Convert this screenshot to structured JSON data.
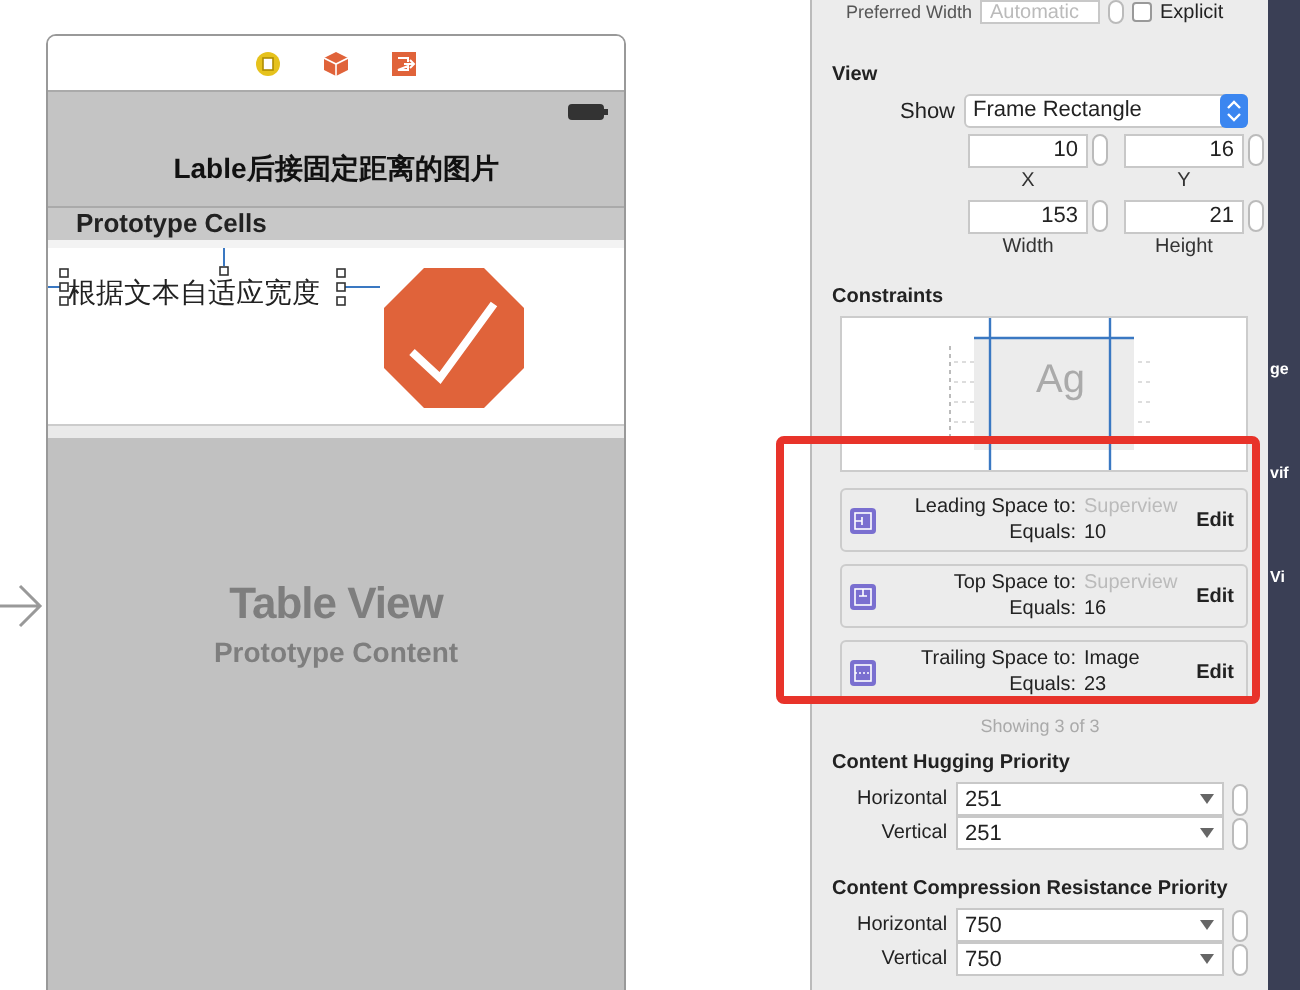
{
  "scene": {
    "title": "Lable后接固定距离的图片",
    "section_header": "Prototype Cells",
    "cell": {
      "label": "根据文本自适应宽度"
    },
    "table_placeholder": {
      "title": "Table View",
      "subtitle": "Prototype Content"
    }
  },
  "inspector": {
    "preferred_width": {
      "label": "Preferred Width",
      "placeholder": "Automatic",
      "explicit": {
        "label": "Explicit",
        "checked": false
      }
    },
    "view": {
      "heading": "View",
      "show": {
        "label": "Show",
        "value": "Frame Rectangle"
      },
      "fields": [
        {
          "label": "X",
          "value": "10"
        },
        {
          "label": "Y",
          "value": "16"
        },
        {
          "label": "Width",
          "value": "153"
        },
        {
          "label": "Height",
          "value": "21"
        }
      ]
    },
    "constraints": {
      "heading": "Constraints",
      "preview_text": "Ag",
      "items": [
        {
          "kind": "leading",
          "relation": "Leading Space to:",
          "target": "Superview",
          "target_dimmed": true,
          "equals_label": "Equals:",
          "value": "10",
          "action": "Edit"
        },
        {
          "kind": "top",
          "relation": "Top Space to:",
          "target": "Superview",
          "target_dimmed": true,
          "equals_label": "Equals:",
          "value": "16",
          "action": "Edit"
        },
        {
          "kind": "trailing",
          "relation": "Trailing Space to:",
          "target": "Image",
          "target_dimmed": false,
          "equals_label": "Equals:",
          "value": "23",
          "action": "Edit"
        }
      ],
      "footer": "Showing 3 of 3"
    },
    "priorities": [
      {
        "heading": "Content Hugging Priority",
        "rows": [
          {
            "label": "Horizontal",
            "value": "251"
          },
          {
            "label": "Vertical",
            "value": "251"
          }
        ]
      },
      {
        "heading": "Content Compression Resistance Priority",
        "rows": [
          {
            "label": "Horizontal",
            "value": "750"
          },
          {
            "label": "Vertical",
            "value": "750"
          }
        ]
      }
    ]
  },
  "background_fragments": [
    "ge",
    "vif",
    "Vi"
  ]
}
